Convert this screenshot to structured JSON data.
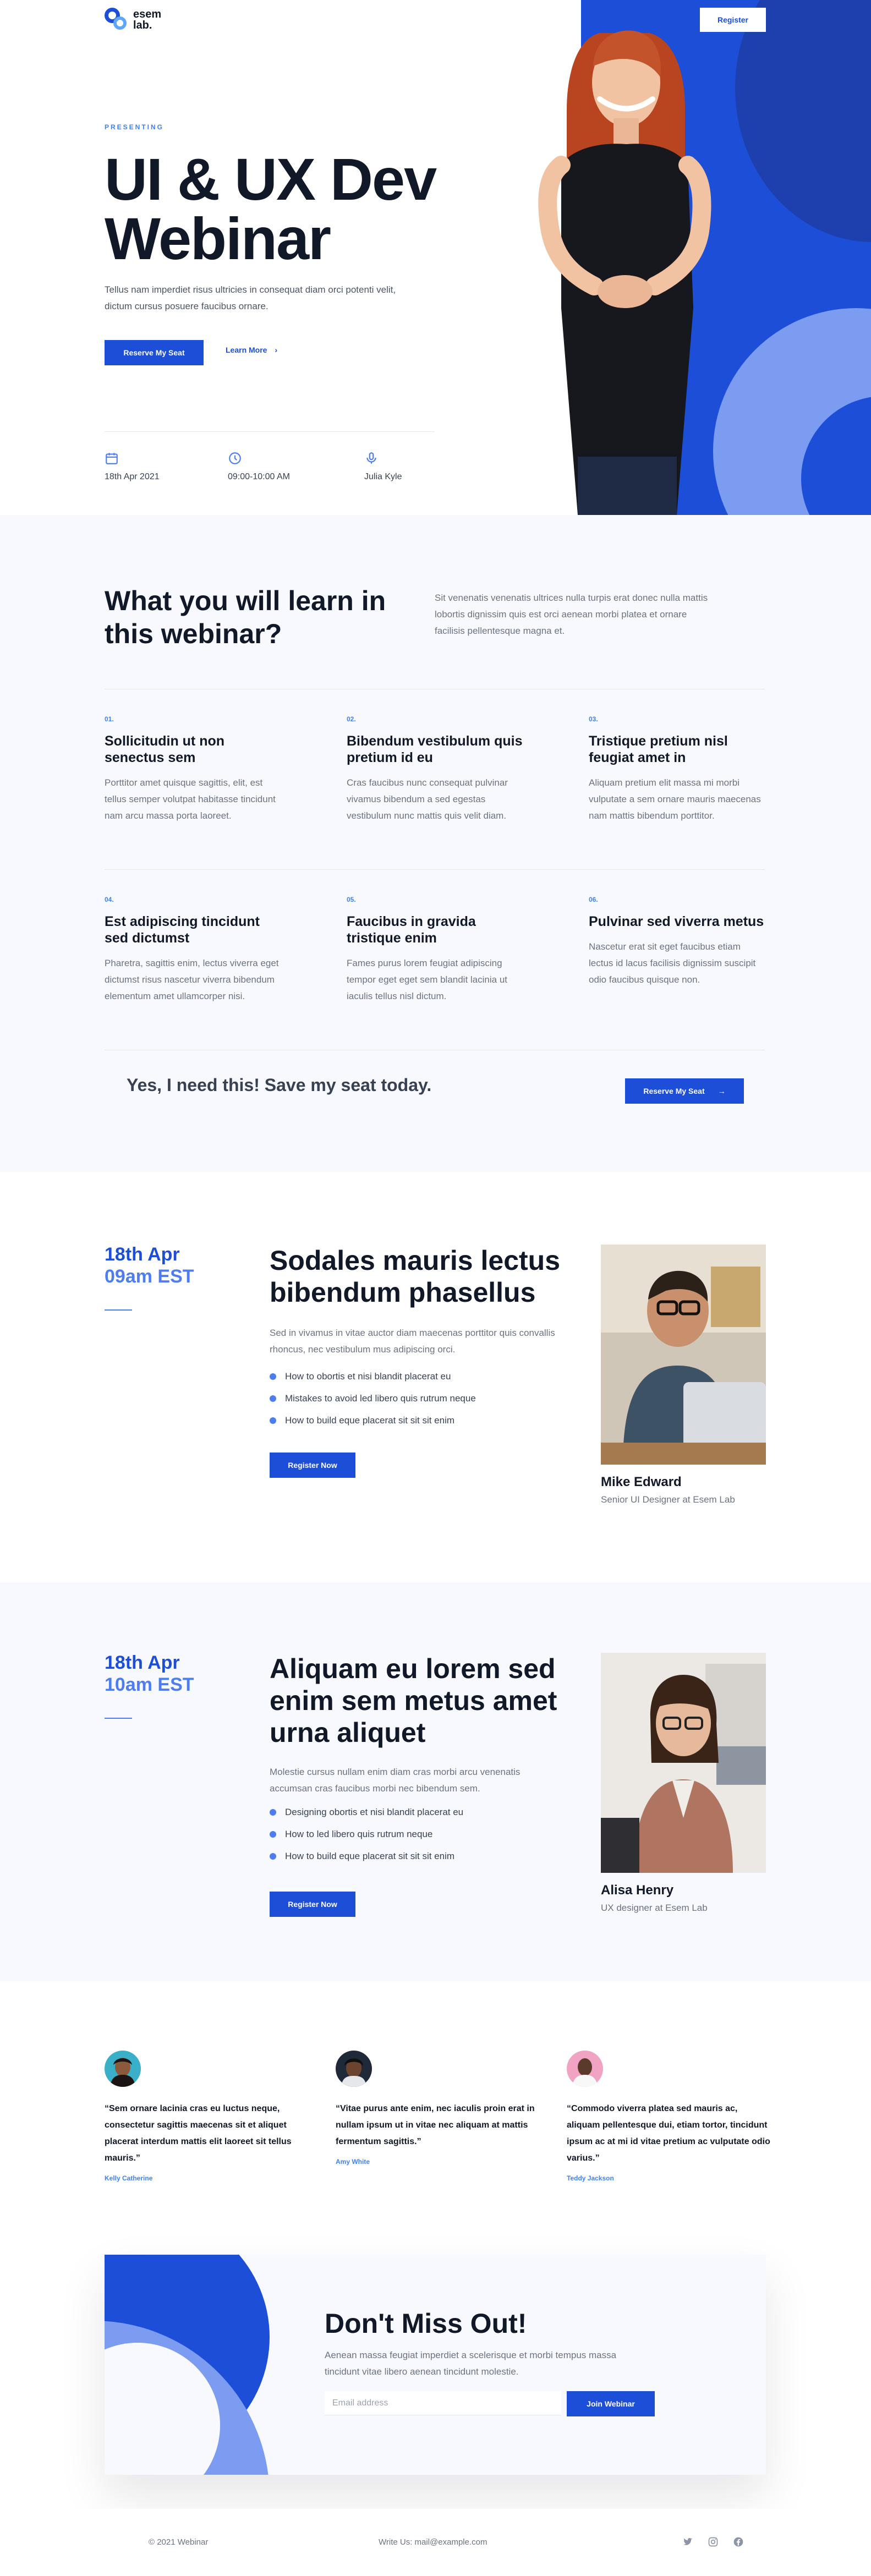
{
  "brand": {
    "name_line1": "esem",
    "name_line2": "lab."
  },
  "nav": {
    "register_label": "Register"
  },
  "hero": {
    "eyebrow": "PRESENTING",
    "title": "UI & UX Dev Webinar",
    "description": "Tellus nam imperdiet risus ultricies in consequat diam orci potenti velit, dictum cursus posuere faucibus ornare.",
    "reserve_label": "Reserve My Seat",
    "learn_more_label": "Learn More",
    "date": "18th Apr 2021",
    "time": "09:00-10:00 AM",
    "speaker": "Julia Kyle"
  },
  "learn": {
    "title": "What you will learn in this webinar?",
    "intro": "Sit venenatis venenatis ultrices nulla turpis erat donec nulla mattis lobortis dignissim quis est orci aenean morbi platea et ornare facilisis pellentesque magna et.",
    "features": [
      {
        "num": "01.",
        "title": "Sollicitudin ut non senectus sem",
        "text": "Porttitor amet quisque sagittis, elit, est tellus semper volutpat habitasse tincidunt nam arcu massa porta laoreet."
      },
      {
        "num": "02.",
        "title": "Bibendum vestibulum quis pretium id eu",
        "text": "Cras faucibus nunc consequat pulvinar vivamus bibendum a sed egestas vestibulum nunc mattis quis velit diam."
      },
      {
        "num": "03.",
        "title": "Tristique pretium nisl feugiat amet in",
        "text": "Aliquam pretium elit massa mi morbi vulputate a sem ornare mauris maecenas nam mattis bibendum porttitor."
      },
      {
        "num": "04.",
        "title": "Est adipiscing tincidunt sed dictumst",
        "text": "Pharetra, sagittis enim, lectus viverra eget dictumst risus nascetur viverra bibendum elementum amet ullamcorper nisi."
      },
      {
        "num": "05.",
        "title": "Faucibus in gravida tristique enim",
        "text": "Fames purus lorem feugiat adipiscing tempor eget eget sem blandit lacinia ut iaculis tellus nisl dictum."
      },
      {
        "num": "06.",
        "title": "Pulvinar sed viverra metus",
        "text": "Nascetur erat sit eget faucibus etiam lectus id lacus facilisis dignissim suscipit odio faucibus quisque non."
      }
    ],
    "cta_text": "Yes, I need this! Save my seat today.",
    "cta_button": "Reserve My Seat"
  },
  "sessions": [
    {
      "date": "18th Apr",
      "time": "09am EST",
      "title": "Sodales mauris lectus bibendum phasellus",
      "description": "Sed in vivamus in vitae auctor diam maecenas porttitor quis convallis rhoncus, nec vestibulum mus adipiscing orci.",
      "bullets": [
        "How to obortis et nisi blandit placerat eu",
        "Mistakes to avoid led libero quis rutrum neque",
        "How to build eque placerat sit sit sit enim"
      ],
      "button": "Register Now",
      "speaker_name": "Mike Edward",
      "speaker_role": "Senior UI Designer at Esem Lab"
    },
    {
      "date": "18th Apr",
      "time": "10am EST",
      "title": "Aliquam eu lorem sed enim sem metus amet urna aliquet",
      "description": "Molestie cursus nullam enim diam cras morbi arcu venenatis accumsan cras faucibus morbi nec bibendum sem.",
      "bullets": [
        "Designing obortis et nisi blandit placerat eu",
        "How to led libero quis rutrum neque",
        "How to build eque placerat sit sit sit enim"
      ],
      "button": "Register Now",
      "speaker_name": "Alisa Henry",
      "speaker_role": "UX designer at Esem Lab"
    }
  ],
  "testimonials": [
    {
      "quote": "“Sem ornare lacinia cras eu luctus neque, consectetur sagittis maecenas sit et aliquet placerat interdum mattis elit laoreet sit tellus mauris.”",
      "author": "Kelly Catherine"
    },
    {
      "quote": "“Vitae purus ante enim, nec iaculis proin erat in nullam ipsum ut in vitae nec aliquam at mattis fermentum sagittis.”",
      "author": "Amy White"
    },
    {
      "quote": "“Commodo viverra platea sed mauris ac, aliquam pellentesque dui, etiam tortor, tincidunt ipsum ac at mi id vitae pretium ac vulputate odio varius.”",
      "author": "Teddy Jackson"
    }
  ],
  "newsletter": {
    "title": "Don't Miss Out!",
    "description": "Aenean massa feugiat imperdiet a scelerisque et morbi tempus massa tincidunt vitae libero aenean tincidunt molestie.",
    "email_placeholder": "Email address",
    "button": "Join Webinar"
  },
  "footer": {
    "copyright": "© 2021 Webinar",
    "contact": "Write Us: mail@example.com",
    "social_icons": [
      "twitter-icon",
      "instagram-icon",
      "facebook-icon"
    ]
  },
  "colors": {
    "primary": "#1d4ed8",
    "accent_light": "#7b9cf0",
    "section_bg": "#f8f9ff",
    "text_dark": "#111827"
  }
}
